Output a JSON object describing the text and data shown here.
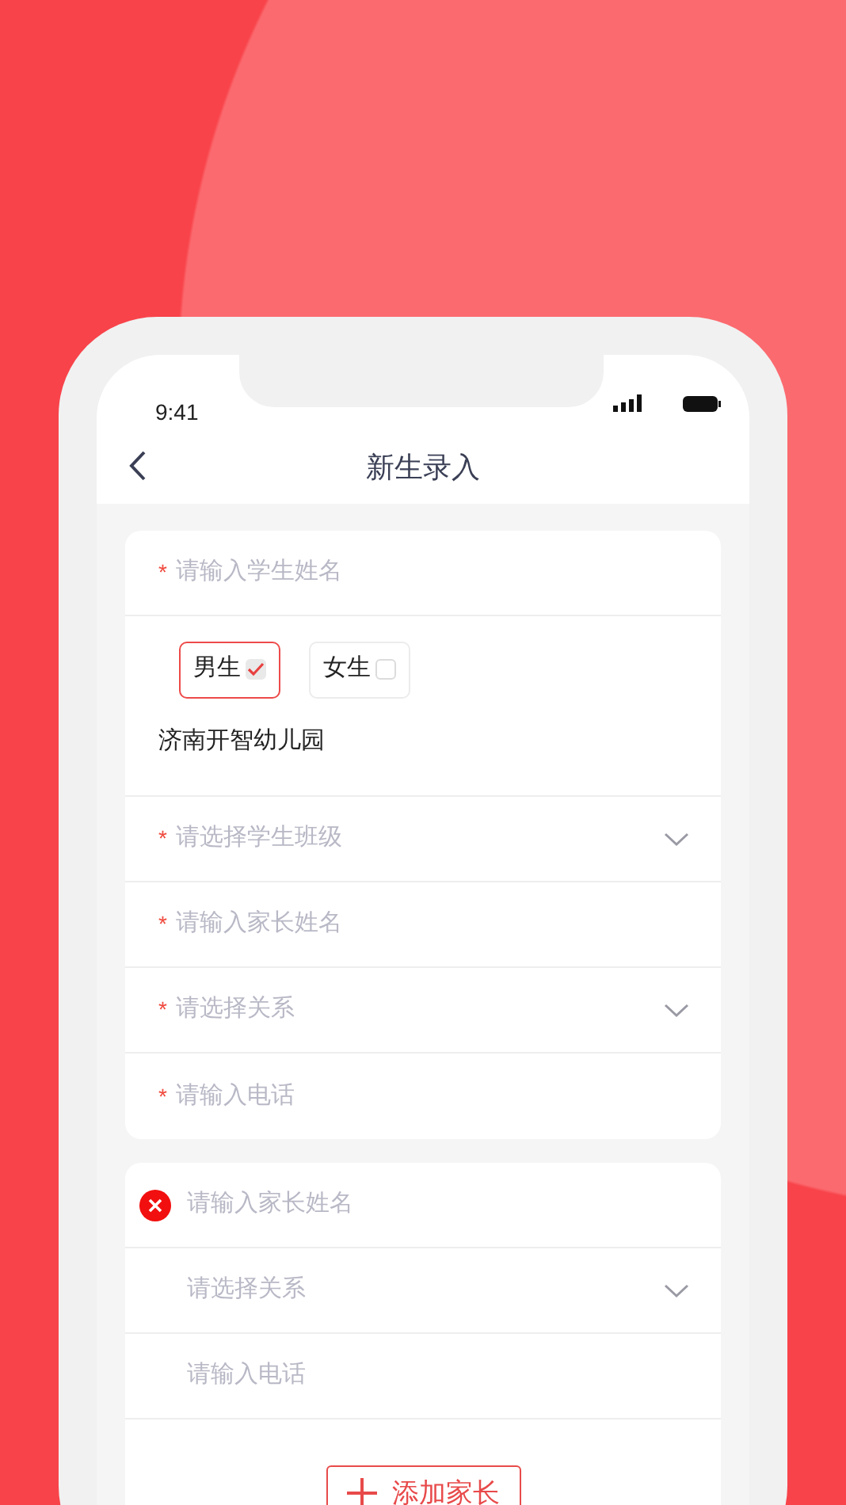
{
  "status_bar": {
    "time": "9:41"
  },
  "nav": {
    "title": "新生录入"
  },
  "student_card": {
    "rows": [
      {
        "kind": "input",
        "marker": "*",
        "placeholder": "请输入学生姓名"
      },
      {
        "kind": "gender",
        "options": [
          {
            "label": "男生",
            "selected": true
          },
          {
            "label": "女生",
            "selected": false
          }
        ]
      },
      {
        "kind": "text",
        "value": "济南开智幼儿园"
      },
      {
        "kind": "select",
        "marker": "*",
        "placeholder": "请选择学生班级"
      },
      {
        "kind": "input",
        "marker": "*",
        "placeholder": "请输入家长姓名"
      },
      {
        "kind": "select",
        "marker": "*",
        "placeholder": "请选择关系"
      },
      {
        "kind": "input",
        "marker": "*",
        "placeholder": "请输入电话"
      }
    ]
  },
  "parent_card": {
    "rows": [
      {
        "kind": "input",
        "removable": true,
        "placeholder": "请输入家长姓名"
      },
      {
        "kind": "select",
        "removable": false,
        "placeholder": "请选择关系"
      },
      {
        "kind": "input",
        "removable": false,
        "placeholder": "请输入电话"
      }
    ],
    "add_button": "添加家长"
  }
}
